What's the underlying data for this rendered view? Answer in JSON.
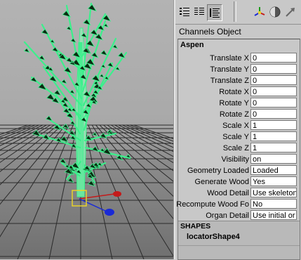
{
  "viewport": {
    "colors": {
      "foliage": "#3cf08c",
      "leaf": "#0b2a12",
      "grid": "#2a2a2a",
      "manip_red": "#c41a1a",
      "manip_blue": "#1a2ad6",
      "selection": "#e8d22a"
    }
  },
  "toolbar": {
    "icons": [
      "channels-layers-icon",
      "attribute-list-icon",
      "channel-box-icon",
      "axis-manipulator-icon",
      "shading-sphere-icon",
      "arrow-tool-icon"
    ]
  },
  "menubar": {
    "channels": "Channels",
    "object": "Object"
  },
  "channel_box": {
    "object_name": "Aspen",
    "attributes": [
      {
        "label": "Translate X",
        "value": "0"
      },
      {
        "label": "Translate Y",
        "value": "0"
      },
      {
        "label": "Translate Z",
        "value": "0"
      },
      {
        "label": "Rotate X",
        "value": "0"
      },
      {
        "label": "Rotate Y",
        "value": "0"
      },
      {
        "label": "Rotate Z",
        "value": "0"
      },
      {
        "label": "Scale X",
        "value": "1"
      },
      {
        "label": "Scale Y",
        "value": "1"
      },
      {
        "label": "Scale Z",
        "value": "1"
      },
      {
        "label": "Visibility",
        "value": "on"
      },
      {
        "label": "Geometry Loaded",
        "value": "Loaded"
      },
      {
        "label": "Generate Wood",
        "value": "Yes"
      },
      {
        "label": "Wood Detail",
        "value": "Use skeleton"
      },
      {
        "label": "Recompute Wood Fo",
        "value": "No"
      },
      {
        "label": "Organ Detail",
        "value": "Use initial or"
      }
    ],
    "shapes_header": "SHAPES",
    "shape_name": "locatorShape4"
  }
}
